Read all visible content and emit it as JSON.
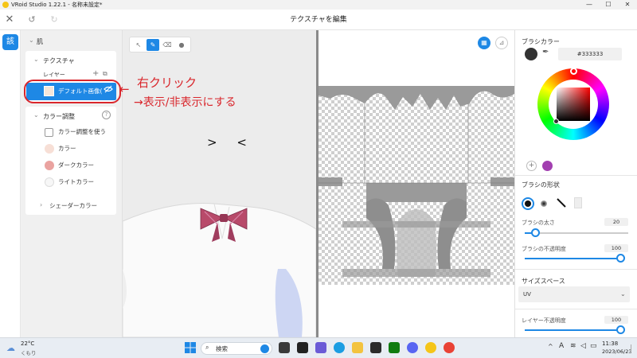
{
  "window": {
    "title": "VRoid Studio 1.22.1 - 名称未設定*",
    "minimize": "—",
    "maximize": "☐",
    "close": "✕"
  },
  "header": {
    "title": "テクスチャを編集",
    "close": "✕",
    "undo": "↺",
    "redo": "↻"
  },
  "rail": {
    "texture_button": "該"
  },
  "left_panel": {
    "section": "肌",
    "texture_group": "テクスチャ",
    "layers_label": "レイヤー",
    "add_layer": "+",
    "import_layer": "⧉",
    "layer_name": "デフォルト画像(",
    "color_adjust_group": "カラー調整",
    "help": "?",
    "use_color_adjust": "カラー調整を使う",
    "colors": [
      {
        "label": "カラー",
        "hex": "#f7dfd6"
      },
      {
        "label": "ダークカラー",
        "hex": "#eaa3a0"
      },
      {
        "label": "ライトカラー",
        "hex": "#f7f7f7"
      }
    ],
    "shader_color": "シェーダーカラー"
  },
  "annotation": {
    "line1": "右クリック",
    "line2": "→表示/非表示にする",
    "arrow": "←"
  },
  "viewport": {
    "eyes": ">  <"
  },
  "right_panel": {
    "brush_color_title": "ブラシカラー",
    "brush_hex": "#333333",
    "brush_shape_title": "ブラシの形状",
    "brush_size_label": "ブラシの太さ",
    "brush_size_value": "20",
    "brush_size_fraction": 0.1,
    "brush_opacity_label": "ブラシの不透明度",
    "brush_opacity_value": "100",
    "brush_opacity_fraction": 1.0,
    "size_space_title": "サイズスペース",
    "size_space_value": "UV",
    "layer_opacity_label": "レイヤー不透明度",
    "layer_opacity_value": "100",
    "layer_opacity_fraction": 1.0,
    "add_swatch": "+",
    "swatch_purple": "#a23fb0"
  },
  "taskbar": {
    "weather_temp": "22°C",
    "weather_desc": "くもり",
    "search_placeholder": "検索",
    "time": "11:38",
    "date": "2023/06/23",
    "ime": "A"
  },
  "colors": {
    "accent": "#1e88e5",
    "annotation": "#d9262c"
  }
}
